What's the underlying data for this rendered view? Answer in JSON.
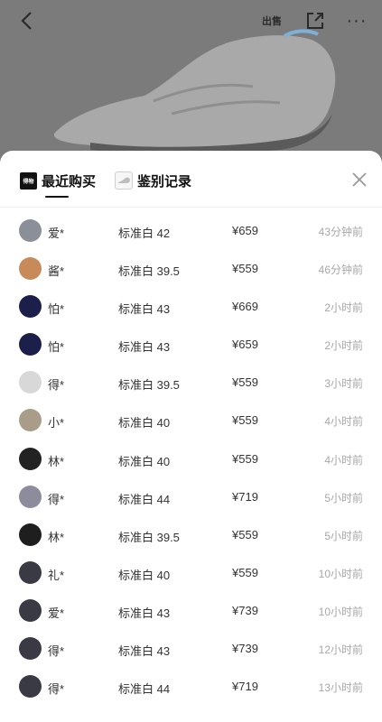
{
  "header": {
    "sell_label": "出售"
  },
  "sheet": {
    "tabs": [
      {
        "label": "最近购买",
        "logo_text": "得物",
        "active": true
      },
      {
        "label": "鉴别记录",
        "active": false
      }
    ]
  },
  "purchases": [
    {
      "user": "爱*",
      "spec": "标准白 42",
      "price": "¥659",
      "time": "43分钟前",
      "avatar_color": "#8a8f98"
    },
    {
      "user": "酱*",
      "spec": "标准白 39.5",
      "price": "¥559",
      "time": "46分钟前",
      "avatar_color": "#c98a5a"
    },
    {
      "user": "怕*",
      "spec": "标准白 43",
      "price": "¥669",
      "time": "2小时前",
      "avatar_color": "#1c1f4a"
    },
    {
      "user": "怕*",
      "spec": "标准白 43",
      "price": "¥659",
      "time": "2小时前",
      "avatar_color": "#1c1f4a"
    },
    {
      "user": "得*",
      "spec": "标准白 39.5",
      "price": "¥559",
      "time": "3小时前",
      "avatar_color": "#d8d8d8"
    },
    {
      "user": "小*",
      "spec": "标准白 40",
      "price": "¥559",
      "time": "4小时前",
      "avatar_color": "#a99c88"
    },
    {
      "user": "林*",
      "spec": "标准白 40",
      "price": "¥559",
      "time": "4小时前",
      "avatar_color": "#222222"
    },
    {
      "user": "得*",
      "spec": "标准白 44",
      "price": "¥719",
      "time": "5小时前",
      "avatar_color": "#8c8c9c"
    },
    {
      "user": "林*",
      "spec": "标准白 39.5",
      "price": "¥559",
      "time": "5小时前",
      "avatar_color": "#1e1e1e"
    },
    {
      "user": "礼*",
      "spec": "标准白 40",
      "price": "¥559",
      "time": "10小时前",
      "avatar_color": "#3a3a44"
    },
    {
      "user": "爱*",
      "spec": "标准白 43",
      "price": "¥739",
      "time": "10小时前",
      "avatar_color": "#3a3a44"
    },
    {
      "user": "得*",
      "spec": "标准白 43",
      "price": "¥739",
      "time": "12小时前",
      "avatar_color": "#3a3a44"
    },
    {
      "user": "得*",
      "spec": "标准白 44",
      "price": "¥719",
      "time": "13小时前",
      "avatar_color": "#3a3a44"
    }
  ]
}
